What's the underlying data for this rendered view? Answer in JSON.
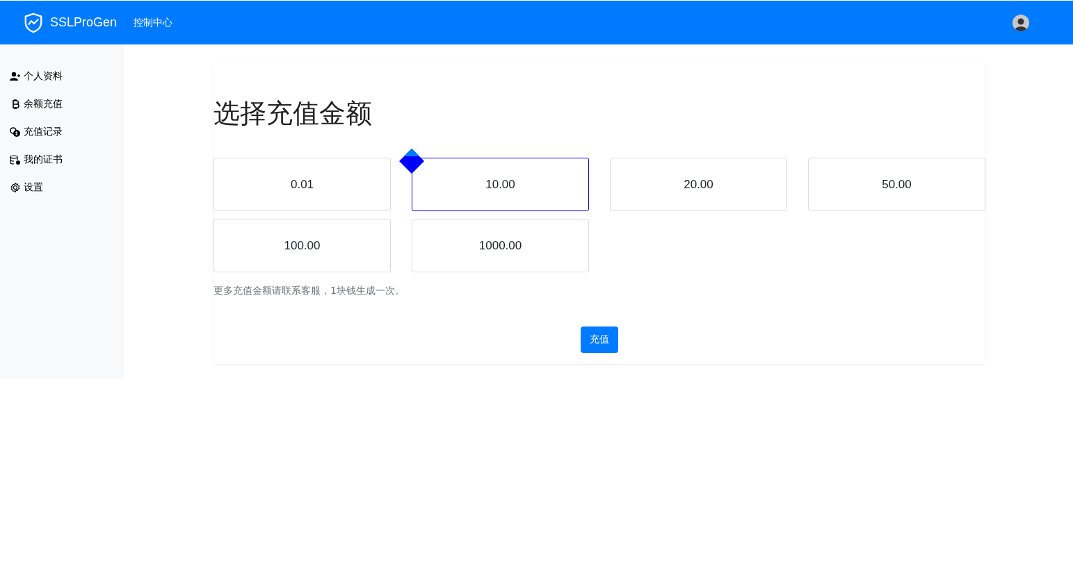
{
  "navbar": {
    "brand": "SSLProGen",
    "link": "控制中心"
  },
  "sidebar": {
    "items": [
      {
        "label": "个人资料",
        "kind": "user"
      },
      {
        "label": "余额充值",
        "kind": "bitcoin"
      },
      {
        "label": "充值记录",
        "kind": "coins"
      },
      {
        "label": "我的证书",
        "kind": "database"
      },
      {
        "label": "设置",
        "kind": "gear"
      }
    ]
  },
  "main": {
    "title": "选择充值金额",
    "amounts": [
      {
        "label": "0.01",
        "selected": false
      },
      {
        "label": "10.00",
        "selected": true
      },
      {
        "label": "20.00",
        "selected": false
      },
      {
        "label": "50.00",
        "selected": false
      },
      {
        "label": "100.00",
        "selected": false
      },
      {
        "label": "1000.00",
        "selected": false
      }
    ],
    "note": "更多充值金额请联系客服，1块钱生成一次。",
    "button": "充值"
  }
}
